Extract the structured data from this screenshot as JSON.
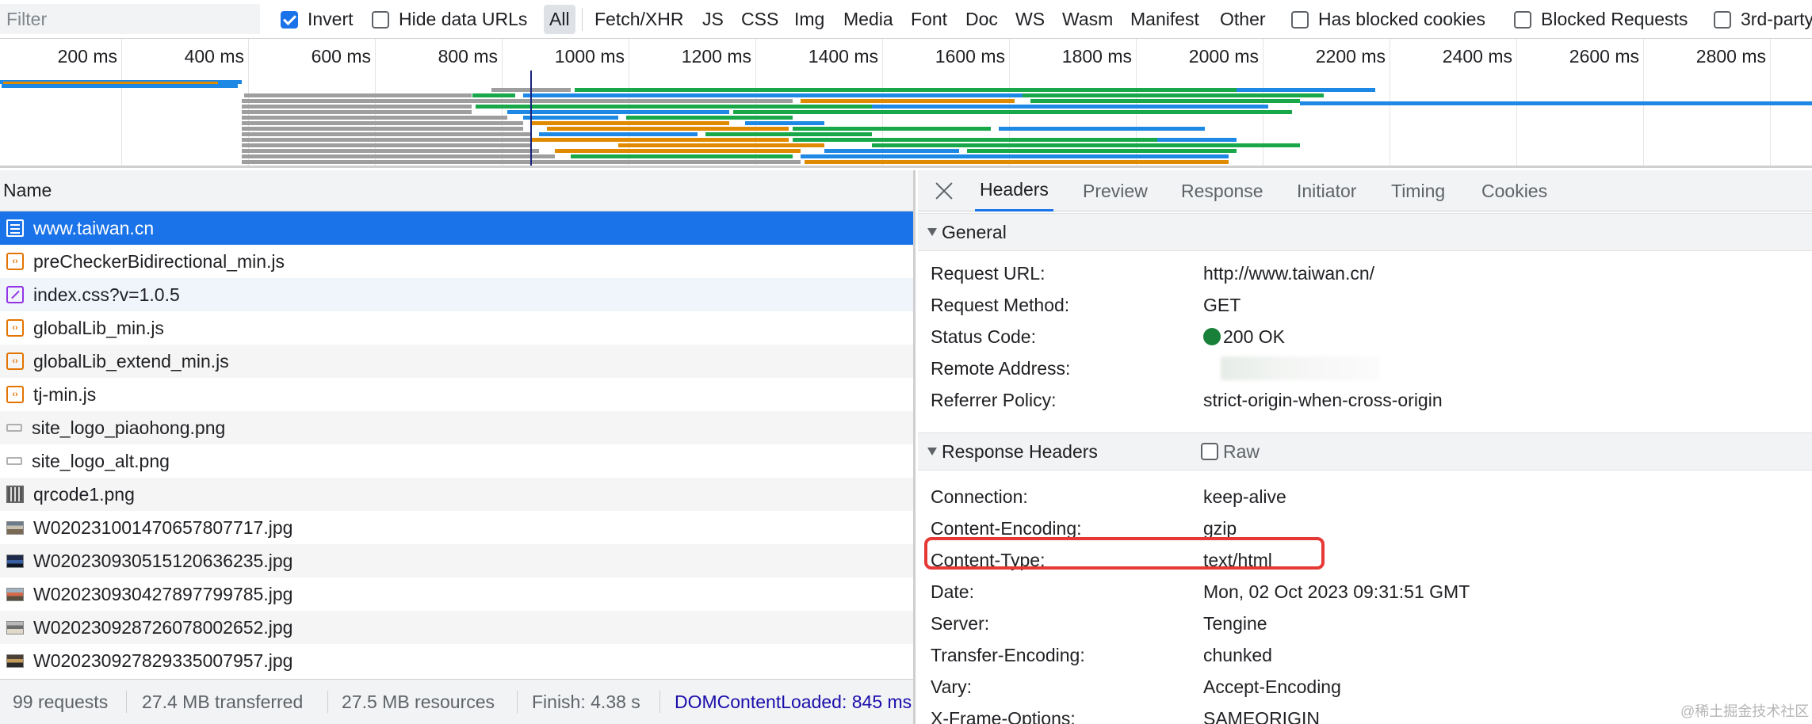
{
  "filter_bar": {
    "placeholder": "Filter",
    "invert": "Invert",
    "hide_data_urls": "Hide data URLs",
    "types": [
      "All",
      "Fetch/XHR",
      "JS",
      "CSS",
      "Img",
      "Media",
      "Font",
      "Doc",
      "WS",
      "Wasm",
      "Manifest",
      "Other"
    ],
    "has_blocked_cookies": "Has blocked cookies",
    "blocked_requests": "Blocked Requests",
    "third_party": "3rd-party"
  },
  "overview": {
    "ticks": [
      "200 ms",
      "400 ms",
      "600 ms",
      "800 ms",
      "1000 ms",
      "1200 ms",
      "1400 ms",
      "1600 ms",
      "1800 ms",
      "2000 ms",
      "2200 ms",
      "2400 ms",
      "2600 ms",
      "2800 ms"
    ]
  },
  "request_list": {
    "column_name": "Name",
    "rows": [
      {
        "name": "www.taiwan.cn",
        "icon": "document-icon"
      },
      {
        "name": "preCheckerBidirectional_min.js",
        "icon": "script-icon"
      },
      {
        "name": "index.css?v=1.0.5",
        "icon": "stylesheet-icon"
      },
      {
        "name": "globalLib_min.js",
        "icon": "script-icon"
      },
      {
        "name": "globalLib_extend_min.js",
        "icon": "script-icon"
      },
      {
        "name": "tj-min.js",
        "icon": "script-icon"
      },
      {
        "name": "site_logo_piaohong.png",
        "icon": "image-icon"
      },
      {
        "name": "site_logo_alt.png",
        "icon": "image-icon"
      },
      {
        "name": "qrcode1.png",
        "icon": "qrcode-image-icon"
      },
      {
        "name": "W020231001470657807717.jpg",
        "icon": "thumbnail-icon"
      },
      {
        "name": "W020230930515120636235.jpg",
        "icon": "thumbnail-icon"
      },
      {
        "name": "W020230930427897799785.jpg",
        "icon": "thumbnail-icon"
      },
      {
        "name": "W020230928726078002652.jpg",
        "icon": "thumbnail-icon"
      },
      {
        "name": "W020230927829335007957.jpg",
        "icon": "thumbnail-icon"
      }
    ],
    "footer": {
      "requests": "99 requests",
      "transferred": "27.4 MB transferred",
      "resources": "27.5 MB resources",
      "finish": "Finish: 4.38 s",
      "dcl": "DOMContentLoaded: 845 ms"
    }
  },
  "details": {
    "tabs": [
      "Headers",
      "Preview",
      "Response",
      "Initiator",
      "Timing",
      "Cookies"
    ],
    "general": {
      "title": "General",
      "request_url_key": "Request URL:",
      "request_url": "http://www.taiwan.cn/",
      "request_method_key": "Request Method:",
      "request_method": "GET",
      "status_code_key": "Status Code:",
      "status_code": "200 OK",
      "remote_address_key": "Remote Address:",
      "referrer_policy_key": "Referrer Policy:",
      "referrer_policy": "strict-origin-when-cross-origin"
    },
    "response_headers": {
      "title": "Response Headers",
      "raw": "Raw",
      "items": [
        {
          "key": "Connection:",
          "value": "keep-alive"
        },
        {
          "key": "Content-Encoding:",
          "value": "gzip"
        },
        {
          "key": "Content-Type:",
          "value": "text/html"
        },
        {
          "key": "Date:",
          "value": "Mon, 02 Oct 2023 09:31:51 GMT"
        },
        {
          "key": "Server:",
          "value": "Tengine"
        },
        {
          "key": "Transfer-Encoding:",
          "value": "chunked"
        },
        {
          "key": "Vary:",
          "value": "Accept-Encoding"
        },
        {
          "key": "X-Frame-Options:",
          "value": "SAMEORIGIN"
        }
      ]
    }
  },
  "watermark": "@稀土掘金技术社区",
  "colors": {
    "accent": "#1a73e8",
    "selected_row": "#1a73e8",
    "status_ok": "#188038",
    "highlight_box": "#e53935",
    "waterfall_blue": "#1e88e5",
    "waterfall_green": "#18a84a",
    "waterfall_orange": "#e08a00",
    "waterfall_gray": "#9e9e9e"
  }
}
